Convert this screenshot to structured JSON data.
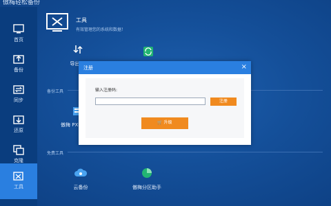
{
  "window": {
    "title": "傲梅轻松备份"
  },
  "sidebar": {
    "items": [
      {
        "label": "首页",
        "icon": "home-icon"
      },
      {
        "label": "备份",
        "icon": "backup-icon"
      },
      {
        "label": "同步",
        "icon": "sync-icon"
      },
      {
        "label": "还原",
        "icon": "restore-icon"
      },
      {
        "label": "克隆",
        "icon": "clone-icon"
      },
      {
        "label": "工具",
        "icon": "tools-icon",
        "active": true
      }
    ]
  },
  "header": {
    "title": "工具",
    "subtitle": "有效管理您的系统和数据！",
    "icon": "tools-monitor-icon"
  },
  "tools": {
    "export_label": "导出/导",
    "backup_tools_label": "备份工具",
    "pxe_label": "傲梅 PXE",
    "free_tools_label": "免费工具",
    "cloud_backup_label": "云备份",
    "partition_label": "傲梅分区助手"
  },
  "dialog": {
    "title": "注册",
    "close": "×",
    "code_label": "输入注册码:",
    "code_value": "",
    "register_button": "注册",
    "buy_button": "🛒 升级"
  },
  "colors": {
    "accent": "#2a7fe0",
    "sidebar": "#0a3d7e",
    "orange": "#f08a1f",
    "background": "#144f99"
  }
}
